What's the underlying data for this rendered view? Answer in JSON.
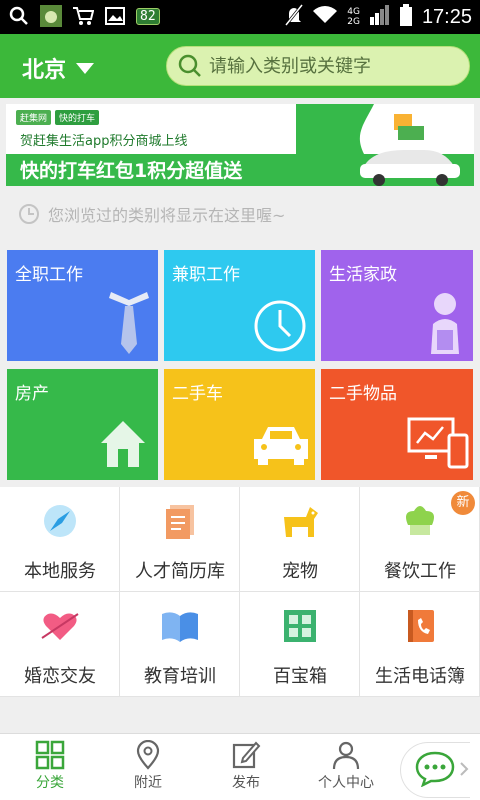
{
  "status_bar": {
    "battery_badge": "82",
    "network": [
      "4G",
      "2G"
    ],
    "time": "17:25"
  },
  "header": {
    "city": "北京",
    "search_placeholder": "请输入类别或关键字"
  },
  "banner": {
    "brand_left": "赶集网",
    "brand_right": "快的打车",
    "subtitle": "贺赶集生活app积分商城上线",
    "title": "快的打车红包1积分超值送"
  },
  "history_hint": "您浏览过的类别将显示在这里喔~",
  "tiles": [
    {
      "label": "全职工作",
      "color": "#4b7cf0",
      "icon": "tie-icon"
    },
    {
      "label": "兼职工作",
      "color": "#2ec9ef",
      "icon": "clock-icon"
    },
    {
      "label": "生活家政",
      "color": "#a063ec",
      "icon": "housekeeper-icon"
    },
    {
      "label": "房产",
      "color": "#36b94a",
      "icon": "house-icon"
    },
    {
      "label": "二手车",
      "color": "#f6c21a",
      "icon": "car-icon"
    },
    {
      "label": "二手物品",
      "color": "#f0562a",
      "icon": "computer-icon"
    }
  ],
  "grid": [
    {
      "label": "本地服务",
      "icon": "compass-icon"
    },
    {
      "label": "人才简历库",
      "icon": "resume-icon"
    },
    {
      "label": "宠物",
      "icon": "dog-icon"
    },
    {
      "label": "餐饮工作",
      "icon": "chef-hat-icon",
      "badge": "新"
    },
    {
      "label": "婚恋交友",
      "icon": "heart-arrow-icon"
    },
    {
      "label": "教育培训",
      "icon": "book-icon"
    },
    {
      "label": "百宝箱",
      "icon": "toolbox-icon"
    },
    {
      "label": "生活电话簿",
      "icon": "phonebook-icon"
    }
  ],
  "bottom_nav": [
    {
      "label": "分类",
      "icon": "category-grid-icon",
      "active": true
    },
    {
      "label": "附近",
      "icon": "location-pin-icon"
    },
    {
      "label": "发布",
      "icon": "edit-icon"
    },
    {
      "label": "个人中心",
      "icon": "person-icon"
    }
  ],
  "colors": {
    "brand_green": "#3cb83a",
    "search_bg": "#dbf2b0",
    "active_nav": "#3aa63a"
  }
}
